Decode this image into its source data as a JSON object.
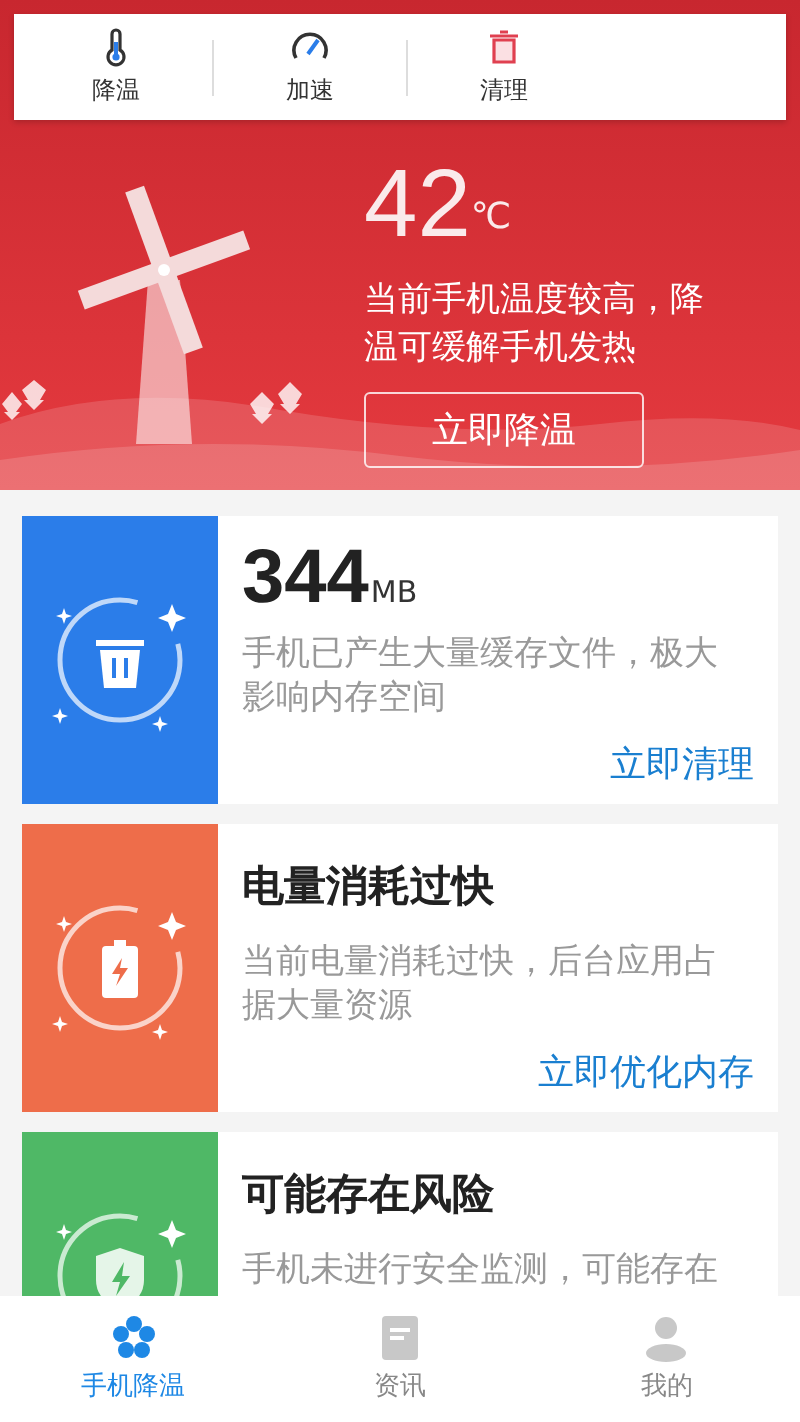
{
  "toolbar": [
    {
      "kind": "thermometer",
      "label": "降温"
    },
    {
      "kind": "gauge",
      "label": "加速"
    },
    {
      "kind": "trash",
      "label": "清理"
    }
  ],
  "temperature": {
    "value": "42",
    "unit": "℃",
    "message": "当前手机温度较高，降温可缓解手机发热",
    "button": "立即降温"
  },
  "cards": [
    {
      "kind": "cleanup",
      "color": "#2b7de9",
      "value": "344",
      "unit": "MB",
      "description": "手机已产生大量缓存文件，极大影响内存空间",
      "action": "立即清理"
    },
    {
      "kind": "battery",
      "color": "#ee6d4a",
      "title": "电量消耗过快",
      "description": "当前电量消耗过快，后台应用占据大量资源",
      "action": "立即优化内存"
    },
    {
      "kind": "security",
      "color": "#4fb866",
      "title": "可能存在风险",
      "description": "手机未进行安全监测，可能存在"
    }
  ],
  "tabs": [
    {
      "kind": "flower",
      "label": "手机降温",
      "selected": true
    },
    {
      "kind": "news",
      "label": "资讯",
      "selected": false
    },
    {
      "kind": "person",
      "label": "我的",
      "selected": false
    }
  ]
}
